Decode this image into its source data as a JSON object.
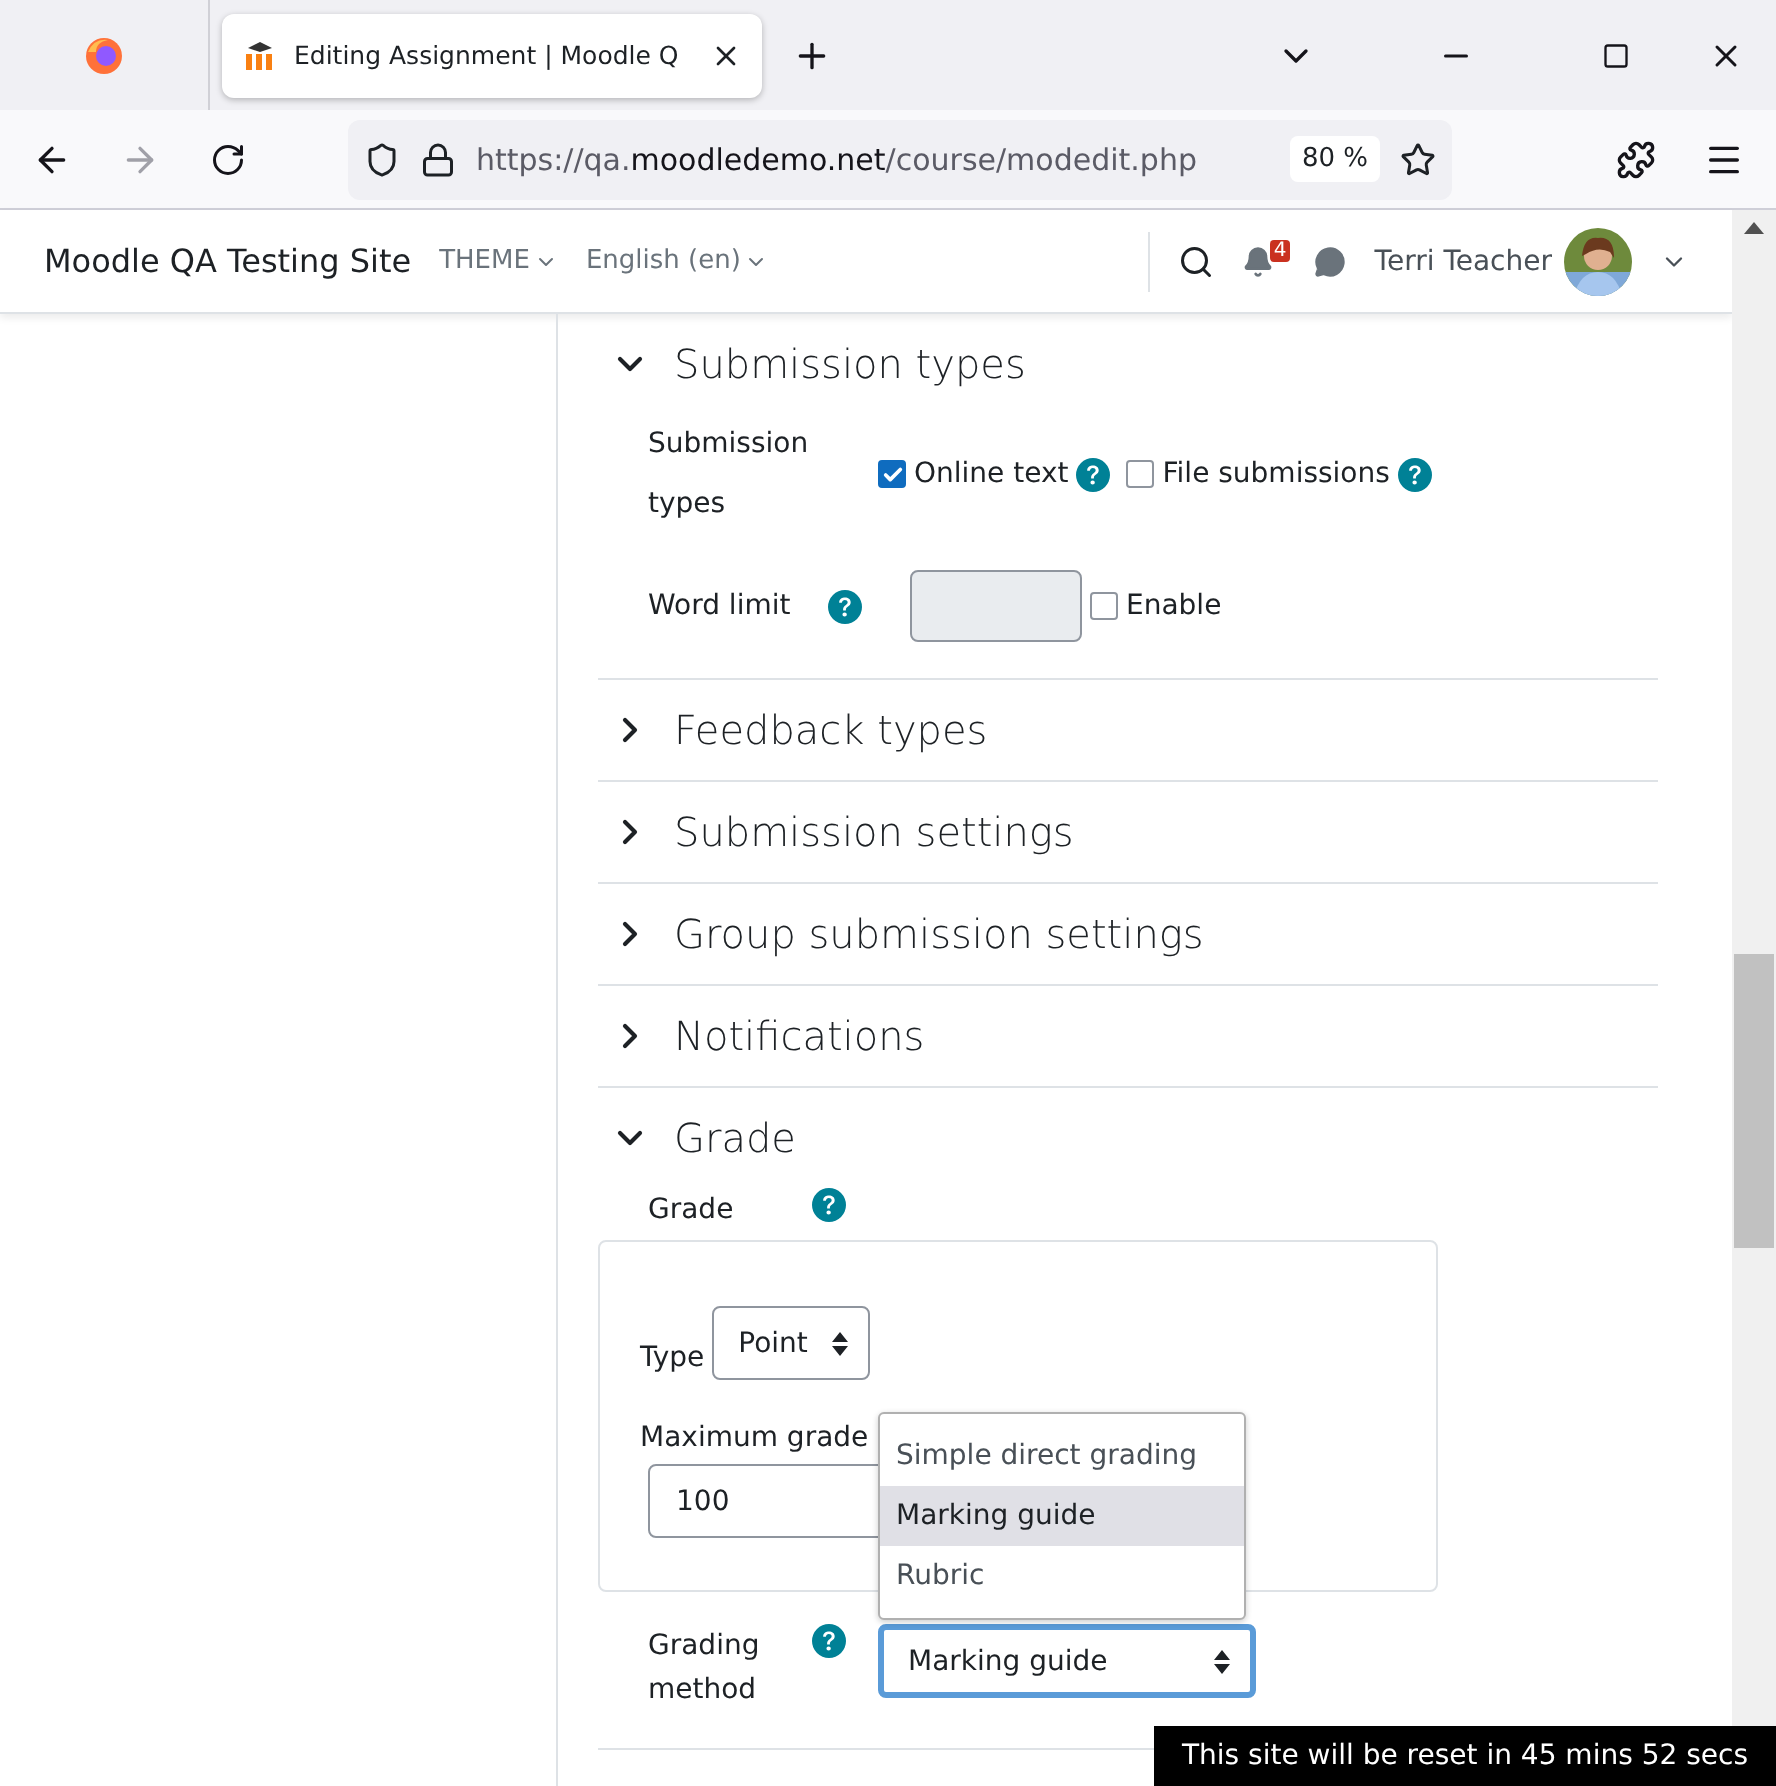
{
  "browser": {
    "tab_title": "Editing Assignment | Moodle Q",
    "url_prefix": "https://qa.",
    "url_domain": "moodledemo.net",
    "url_path": "/course/modedit.php",
    "zoom": "80 %"
  },
  "navbar": {
    "site_name": "Moodle QA Testing Site",
    "menus": [
      "THEME",
      "English (en)"
    ],
    "notification_count": "4",
    "user_name": "Terri Teacher"
  },
  "sections": [
    {
      "title": "Submission types",
      "expanded": true,
      "kind": "submission",
      "label": "Submission types",
      "options": [
        {
          "label": "Online text",
          "checked": true
        },
        {
          "label": "File submissions",
          "checked": false
        }
      ],
      "word_limit": {
        "label": "Word limit",
        "disabled": true,
        "enable": {
          "label": "Enable",
          "checked": false
        }
      }
    },
    {
      "title": "Feedback types",
      "expanded": false
    },
    {
      "title": "Submission settings",
      "expanded": false
    },
    {
      "title": "Group submission settings",
      "expanded": false
    },
    {
      "title": "Notifications",
      "expanded": false
    },
    {
      "title": "Grade",
      "expanded": true,
      "kind": "grade",
      "label": "Grade",
      "type": {
        "label": "Type",
        "value": "Point"
      },
      "max_grade": {
        "label": "Maximum grade",
        "value": "100"
      },
      "grading_method": {
        "label": "Grading method",
        "value": "Marking guide",
        "open": true,
        "options": [
          {
            "label": "Simple direct grading",
            "selected": false
          },
          {
            "label": "Marking guide",
            "selected": true
          },
          {
            "label": "Rubric",
            "selected": false
          }
        ]
      }
    }
  ],
  "toast": "This site will be reset in 45 mins 52 secs"
}
